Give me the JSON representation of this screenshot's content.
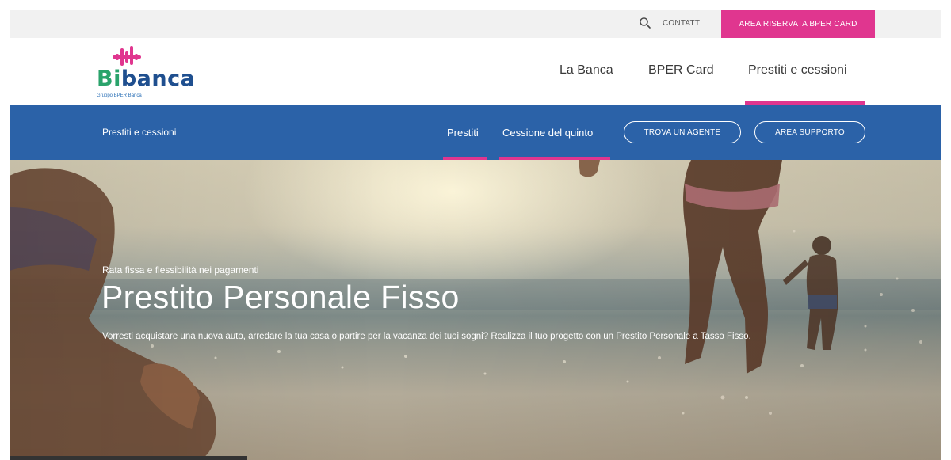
{
  "utility": {
    "contatti_label": "CONTATTI",
    "area_riservata_label": "AREA RISERVATA BPER CARD"
  },
  "brand": {
    "name_bi": "Bi",
    "name_rest": "banca",
    "group_line": "Gruppo BPER Banca",
    "accent_color": "#e0368f",
    "primary_color": "#2b62a8"
  },
  "main_nav": {
    "items": [
      {
        "label": "La Banca"
      },
      {
        "label": "BPER Card"
      },
      {
        "label": "Prestiti e cessioni",
        "active": true
      }
    ]
  },
  "sub_nav": {
    "section_title": "Prestiti e cessioni",
    "links": [
      {
        "label": "Prestiti",
        "active": true
      },
      {
        "label": "Cessione del quinto",
        "active": true
      }
    ],
    "buttons": [
      {
        "label": "TROVA UN AGENTE"
      },
      {
        "label": "AREA SUPPORTO"
      }
    ]
  },
  "hero": {
    "kicker": "Rata fissa e flessibilità nei pagamenti",
    "title": "Prestito Personale Fisso",
    "description": "Vorresti acquistare una nuova auto, arredare la tua casa o partire per la vacanza dei tuoi sogni? Realizza il tuo progetto con un Prestito Personale a Tasso Fisso."
  }
}
